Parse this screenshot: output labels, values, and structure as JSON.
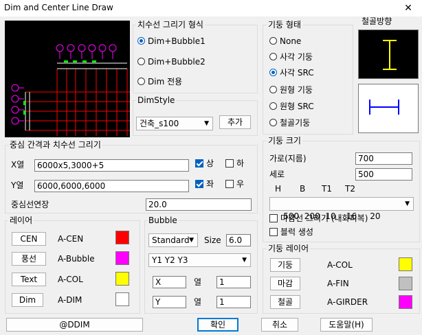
{
  "window": {
    "title": "Dim and Center Line Draw",
    "close_glyph": "✕"
  },
  "dim_draw_type": {
    "title": "치수선 그리기 형식",
    "options": [
      {
        "label": "Dim+Bubble1",
        "selected": true
      },
      {
        "label": "Dim+Bubble2",
        "selected": false
      },
      {
        "label": "Dim 전용",
        "selected": false
      }
    ]
  },
  "dim_style": {
    "title": "DimStyle",
    "value": "건축_s100",
    "add_label": "추가"
  },
  "column_type": {
    "title": "기둥 형태",
    "options": [
      {
        "label": "None",
        "selected": false
      },
      {
        "label": "사각 기둥",
        "selected": false
      },
      {
        "label": "사각 SRC",
        "selected": true
      },
      {
        "label": "원형 기둥",
        "selected": false
      },
      {
        "label": "원형 SRC",
        "selected": false
      },
      {
        "label": "철골기둥",
        "selected": false
      }
    ]
  },
  "steel_direction": {
    "title": "철골방향"
  },
  "center_grid": {
    "title": "중심 간격과 치수선 그리기",
    "x_label": "X열",
    "x_value": "6000x5,3000+5",
    "y_label": "Y열",
    "y_value": "6000,6000,6000",
    "x_check_top": {
      "label": "상",
      "checked": true
    },
    "x_check_bottom": {
      "label": "하",
      "checked": false
    },
    "y_check_left": {
      "label": "좌",
      "checked": true
    },
    "y_check_right": {
      "label": "우",
      "checked": false
    },
    "extend_label": "중심선연장",
    "extend_value": "20.0"
  },
  "column_size": {
    "title": "기둥 크기",
    "width_label": "가로(지름)",
    "width_value": "700",
    "height_label": "세로",
    "height_value": "500",
    "headers": [
      "H",
      "B",
      "T1",
      "T2"
    ],
    "steel_value": "500  200  10    16     20",
    "finish_check": {
      "label": "마감선 그리기 (내화피복)",
      "checked": false
    },
    "block_check": {
      "label": "블럭 생성",
      "checked": false
    }
  },
  "layer": {
    "title": "레이어",
    "rows": [
      {
        "button": "CEN",
        "name": "A-CEN",
        "color": "#ff0000"
      },
      {
        "button": "풍선",
        "name": "A-Bubble",
        "color": "#ff00ff"
      },
      {
        "button": "Text",
        "name": "A-COL",
        "color": "#ffff00"
      },
      {
        "button": "Dim",
        "name": "A-DIM",
        "color": "#ffffff"
      }
    ]
  },
  "bubble": {
    "title": "Bubble",
    "style_value": "Standard",
    "size_label": "Size",
    "size_value": "6.0",
    "format_value": "Y1 Y2 Y3",
    "x_prefix": "X",
    "x_col_label": "열",
    "x_start": "1",
    "y_prefix": "Y",
    "y_col_label": "열",
    "y_start": "1"
  },
  "column_layer": {
    "title": "기둥 레이어",
    "rows": [
      {
        "button": "기둥",
        "name": "A-COL",
        "color": "#ffff00"
      },
      {
        "button": "마감",
        "name": "A-FIN",
        "color": "#c0c0c0"
      },
      {
        "button": "철골",
        "name": "A-GIRDER",
        "color": "#ff00ff"
      }
    ]
  },
  "footer": {
    "ddim": "@DDIM",
    "ok": "확인",
    "cancel": "취소",
    "help": "도움말(H)"
  },
  "colors": {
    "preview_bg": "#000000",
    "grid": "#ff0000",
    "dim": "#ffffff",
    "bubble": "#ff00ff",
    "column": "#00ff00",
    "steel_h": "#ffff00",
    "steel_v": "#0000ff",
    "accent": "#0078d7"
  }
}
